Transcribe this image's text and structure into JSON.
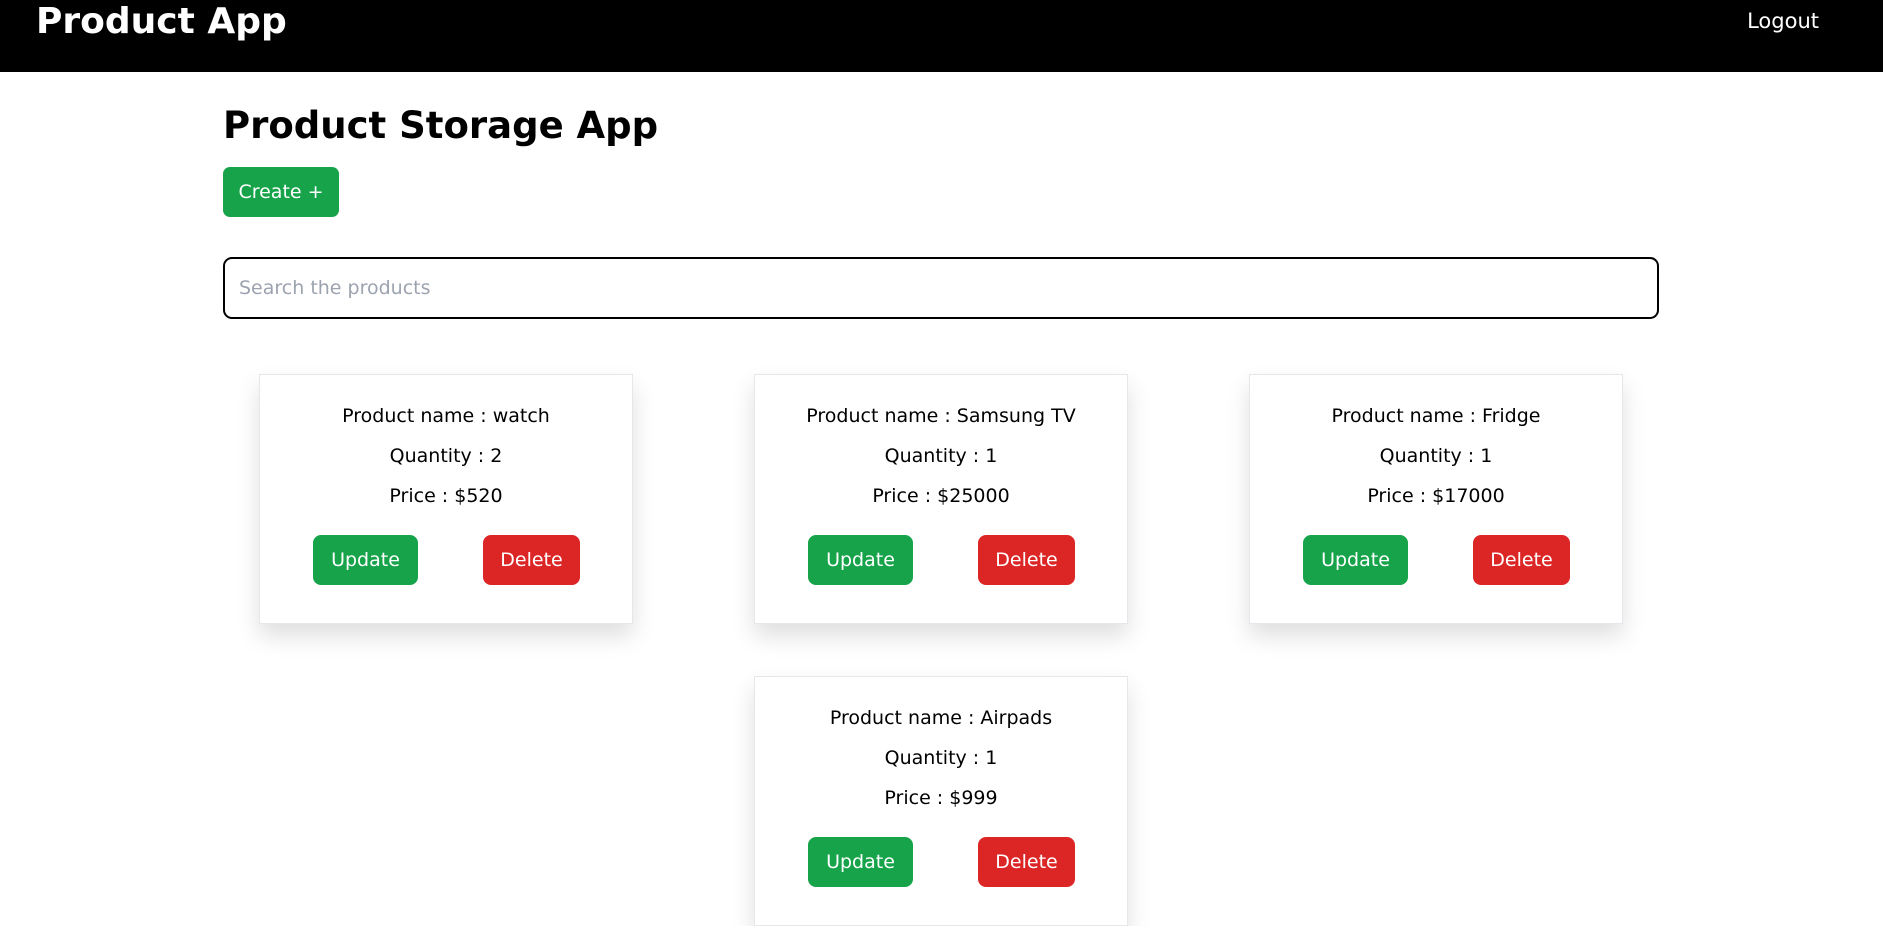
{
  "header": {
    "brand": "Product App",
    "logout_label": "Logout"
  },
  "main": {
    "title": "Product Storage App",
    "create_label": "Create +",
    "search_placeholder": "Search the products"
  },
  "products": [
    {
      "name": "Product name : watch",
      "quantity": "Quantity : 2",
      "price": "Price : $520",
      "update_label": "Update",
      "delete_label": "Delete"
    },
    {
      "name": "Product name : Samsung TV",
      "quantity": "Quantity : 1",
      "price": "Price : $25000",
      "update_label": "Update",
      "delete_label": "Delete"
    },
    {
      "name": "Product name : Fridge",
      "quantity": "Quantity : 1",
      "price": "Price : $17000",
      "update_label": "Update",
      "delete_label": "Delete"
    },
    {
      "name": "Product name : Airpads",
      "quantity": "Quantity : 1",
      "price": "Price : $999",
      "update_label": "Update",
      "delete_label": "Delete"
    }
  ],
  "colors": {
    "topbar": "#000000",
    "create": "#16a34a",
    "update": "#16a34a",
    "delete": "#dc2626"
  }
}
